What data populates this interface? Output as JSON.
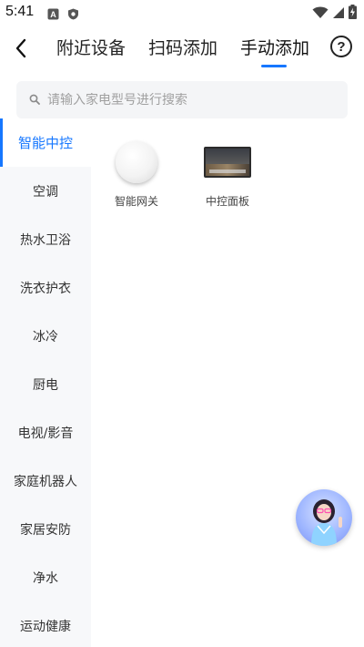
{
  "status_bar": {
    "time": "5:41",
    "left_icons": [
      "a-box-icon",
      "shield-icon"
    ],
    "right_icons": [
      "wifi-icon",
      "signal-icon",
      "battery-charging-icon"
    ]
  },
  "top_nav": {
    "tabs": [
      {
        "label": "附近设备",
        "active": false
      },
      {
        "label": "扫码添加",
        "active": false
      },
      {
        "label": "手动添加",
        "active": true
      }
    ],
    "help_label": "?",
    "accent": "#1677ff"
  },
  "search": {
    "placeholder": "请输入家电型号进行搜索",
    "value": ""
  },
  "sidebar": {
    "items": [
      {
        "label": "智能中控",
        "active": true
      },
      {
        "label": "空调",
        "active": false
      },
      {
        "label": "热水卫浴",
        "active": false
      },
      {
        "label": "洗衣护衣",
        "active": false
      },
      {
        "label": "冰冷",
        "active": false
      },
      {
        "label": "厨电",
        "active": false
      },
      {
        "label": "电视/影音",
        "active": false
      },
      {
        "label": "家庭机器人",
        "active": false
      },
      {
        "label": "家居安防",
        "active": false
      },
      {
        "label": "净水",
        "active": false
      },
      {
        "label": "运动健康",
        "active": false
      }
    ]
  },
  "devices": [
    {
      "label": "智能网关",
      "icon": "gateway-disc-icon"
    },
    {
      "label": "中控面板",
      "icon": "control-panel-icon"
    }
  ],
  "assistant": {
    "icon": "virtual-assistant-avatar"
  }
}
